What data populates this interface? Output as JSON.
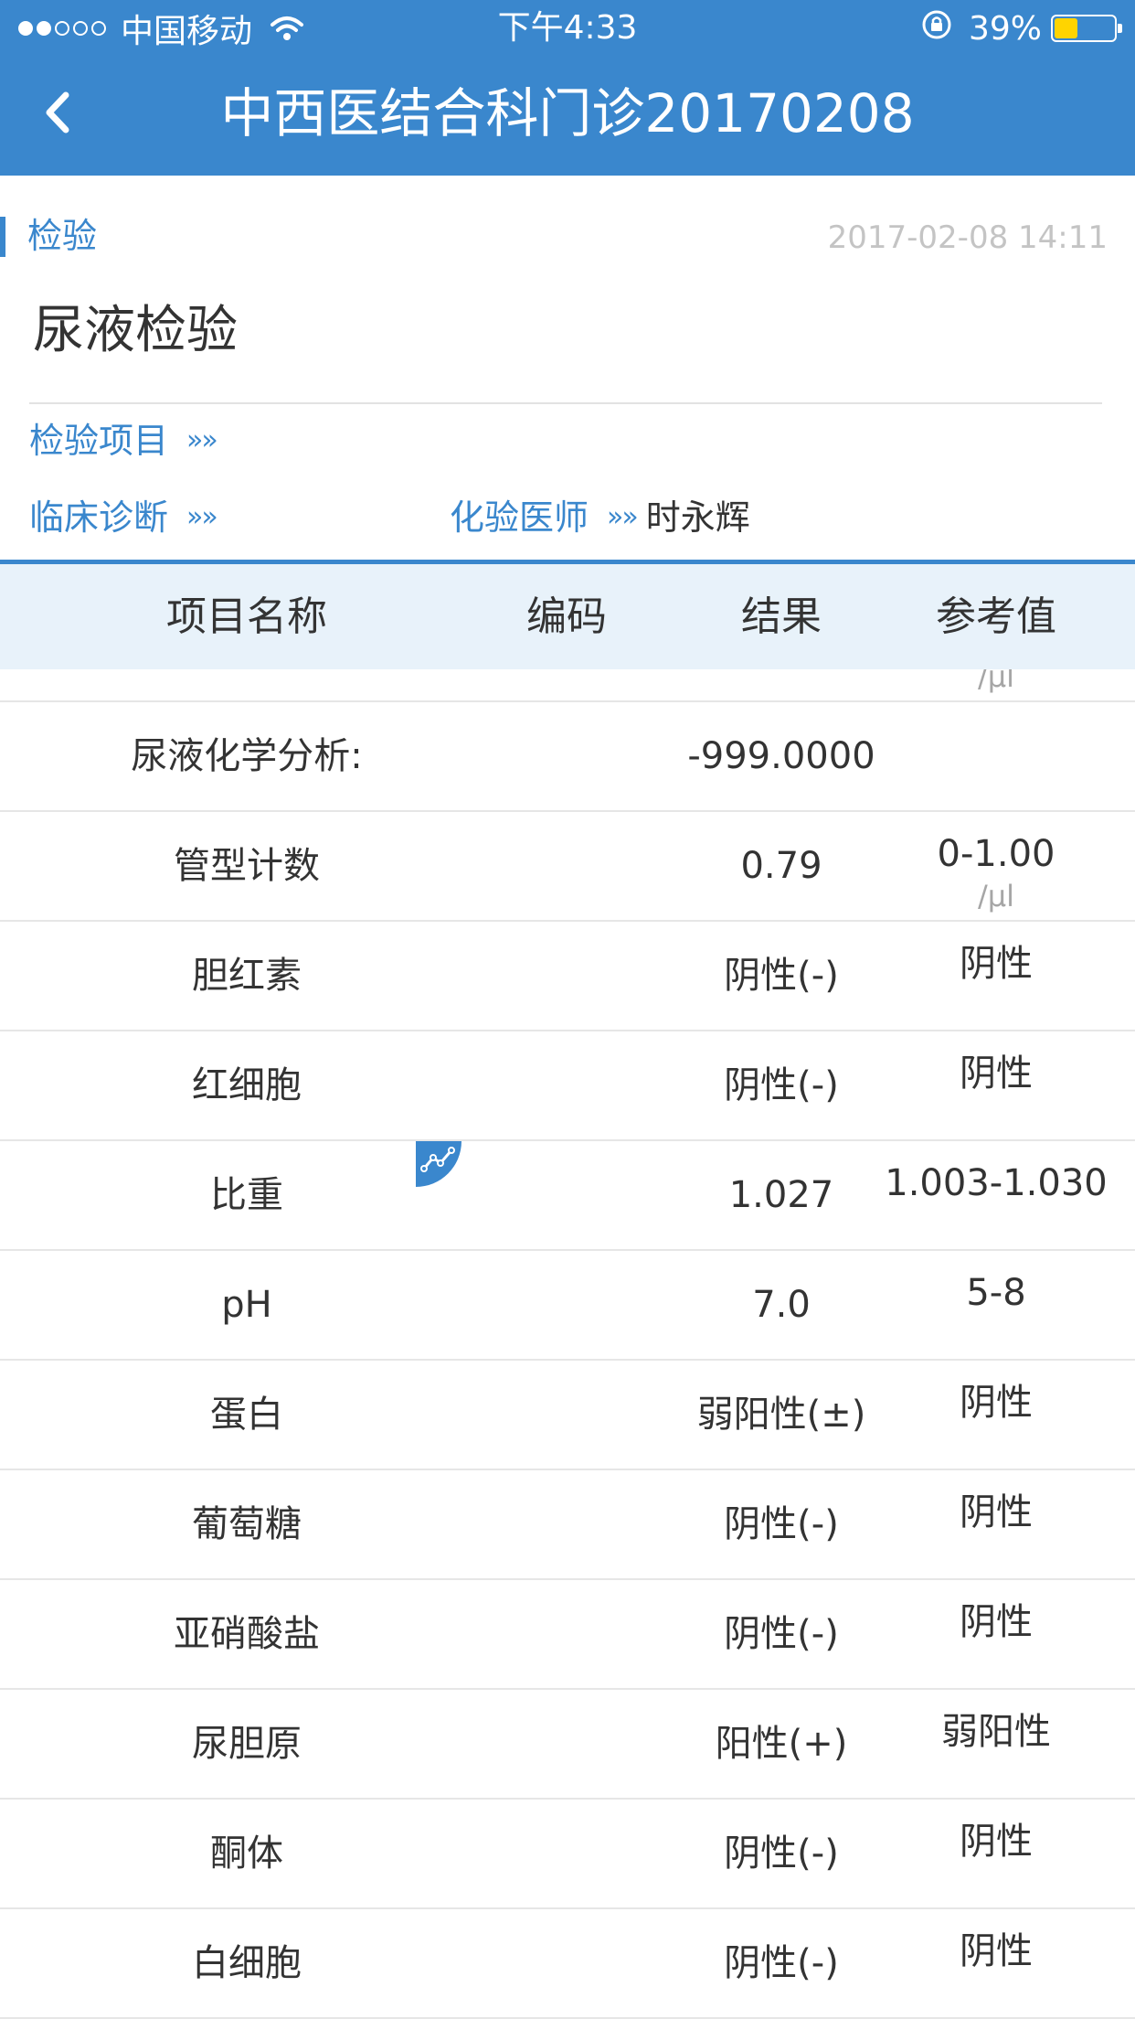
{
  "status_bar": {
    "carrier": "中国移动",
    "time": "下午4:33",
    "battery_percent": "39%",
    "battery_level": 0.39,
    "signal_dots_filled": 2,
    "signal_dots_total": 5
  },
  "navbar": {
    "title": "中西医结合科门诊20170208",
    "back_icon": "chevron-left-icon",
    "color": "#3a87cd"
  },
  "report": {
    "category_tag": "检验",
    "datetime": "2017-02-08 14:11",
    "title": "尿液检验",
    "fields": {
      "test_items_label": "检验项目",
      "clinical_diagnosis_label": "临床诊断",
      "lab_doctor_label": "化验医师",
      "lab_doctor_value": "时永辉",
      "arrow_glyph": "»»"
    }
  },
  "table": {
    "headers": {
      "name": "项目名称",
      "code": "编码",
      "result": "结果",
      "reference": "参考值"
    },
    "partial_top_unit": "/µl",
    "rows": [
      {
        "name": "尿液化学分析:",
        "code": "",
        "result": "-999.0000",
        "reference": "",
        "unit": ""
      },
      {
        "name": "管型计数",
        "code": "",
        "result": "0.79",
        "reference": "0-1.00",
        "unit": "/µl"
      },
      {
        "name": "胆红素",
        "code": "",
        "result": "阴性(-)",
        "reference": "阴性",
        "unit": ""
      },
      {
        "name": "红细胞",
        "code": "",
        "result": "阴性(-)",
        "reference": "阴性",
        "unit": ""
      },
      {
        "name": "比重",
        "code": "",
        "result": "1.027",
        "reference": "1.003-1.030",
        "unit": ""
      },
      {
        "name": "pH",
        "code": "",
        "result": "7.0",
        "reference": "5-8",
        "unit": ""
      },
      {
        "name": "蛋白",
        "code": "",
        "result": "弱阳性(±)",
        "reference": "阴性",
        "unit": ""
      },
      {
        "name": "葡萄糖",
        "code": "",
        "result": "阴性(-)",
        "reference": "阴性",
        "unit": ""
      },
      {
        "name": "亚硝酸盐",
        "code": "",
        "result": "阴性(-)",
        "reference": "阴性",
        "unit": ""
      },
      {
        "name": "尿胆原",
        "code": "",
        "result": "阳性(+)",
        "reference": "弱阳性",
        "unit": ""
      },
      {
        "name": "酮体",
        "code": "",
        "result": "阴性(-)",
        "reference": "阴性",
        "unit": ""
      },
      {
        "name": "白细胞",
        "code": "",
        "result": "阴性(-)",
        "reference": "阴性",
        "unit": ""
      }
    ]
  },
  "trend_badge_icon": "trend-chart-icon"
}
